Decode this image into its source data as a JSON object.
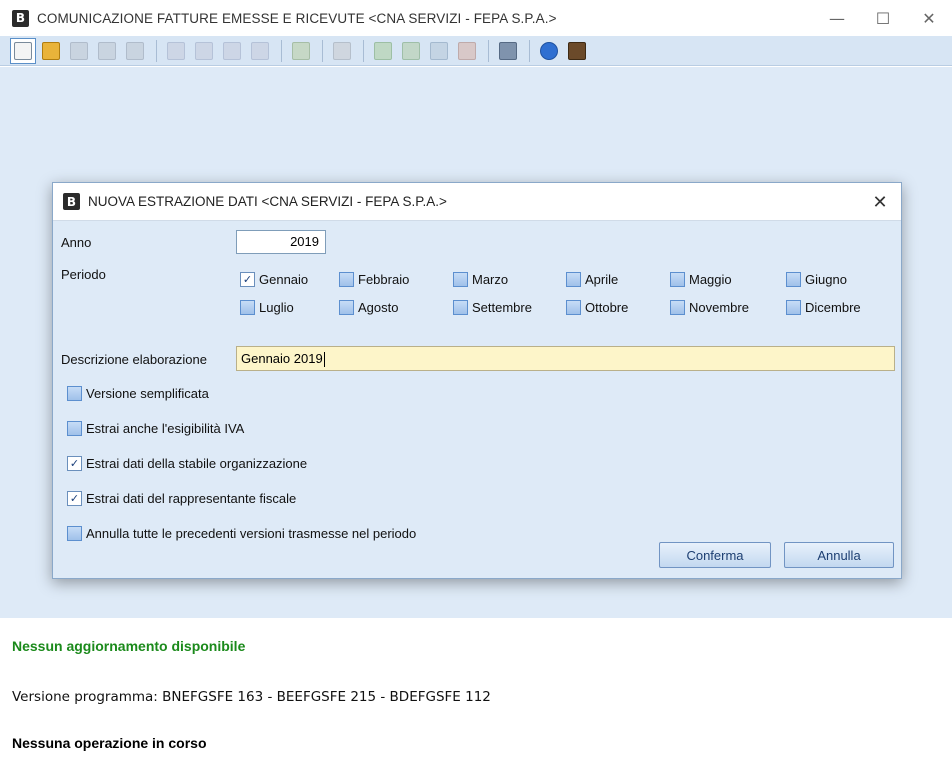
{
  "window": {
    "logo": "B",
    "title": "COMUNICAZIONE FATTURE EMESSE E RICEVUTE <CNA SERVIZI - FEPA S.P.A.>",
    "controls": {
      "minimize": "—",
      "maximize": "☐",
      "close": "✕"
    }
  },
  "toolbar": {
    "icons": [
      {
        "name": "new-document-icon",
        "color": "#f4f4f4",
        "border": "#7a8a9a",
        "selected": true
      },
      {
        "name": "open-folder-icon",
        "color": "#e9b33a",
        "border": "#b07d10"
      },
      {
        "name": "undo-icon",
        "color": "#c9d4e0",
        "border": "#b0bccb"
      },
      {
        "name": "delete-icon",
        "color": "#c9d4e0",
        "border": "#b0bccb"
      },
      {
        "name": "search-binoculars-icon",
        "color": "#c9d4e0",
        "border": "#b0bccb"
      },
      {
        "name": "sep"
      },
      {
        "name": "edit-pencil-icon",
        "color": "#cdd6e6",
        "border": "#b5c2d8"
      },
      {
        "name": "edit-pencil-2-icon",
        "color": "#cdd6e6",
        "border": "#b5c2d8"
      },
      {
        "name": "edit-pencil-3-icon",
        "color": "#cdd6e6",
        "border": "#b5c2d8"
      },
      {
        "name": "cancel-edit-icon",
        "color": "#cdd6e6",
        "border": "#b5c2d8"
      },
      {
        "name": "sep"
      },
      {
        "name": "list-dropdown-icon",
        "color": "#c6d8c6",
        "border": "#a6bea6"
      },
      {
        "name": "sep"
      },
      {
        "name": "settings-gear-icon",
        "color": "#cfd6df",
        "border": "#b5bfcb"
      },
      {
        "name": "sep"
      },
      {
        "name": "user-icon",
        "color": "#bfd8c4",
        "border": "#9dbfa4"
      },
      {
        "name": "chart-icon",
        "color": "#c2d7c8",
        "border": "#9fbfa8"
      },
      {
        "name": "copy-icon",
        "color": "#c4d4e4",
        "border": "#a4b9cf"
      },
      {
        "name": "report-icon",
        "color": "#d8c8c8",
        "border": "#bfaaaa"
      },
      {
        "name": "sep"
      },
      {
        "name": "monitor-icon",
        "color": "#7f93ad",
        "border": "#566a84"
      },
      {
        "name": "sep"
      },
      {
        "name": "help-icon",
        "color": "#2f6fd1",
        "border": "#1f52a0",
        "round": true
      },
      {
        "name": "exit-door-icon",
        "color": "#6b4a2a",
        "border": "#3e2a14"
      }
    ]
  },
  "dialog": {
    "logo": "B",
    "title": "NUOVA ESTRAZIONE DATI <CNA SERVIZI - FEPA S.P.A.>",
    "close": "✕",
    "anno_label": "Anno",
    "anno_value": "2019",
    "periodo_label": "Periodo",
    "months": [
      {
        "label": "Gennaio",
        "checked": true
      },
      {
        "label": "Febbraio",
        "checked": false
      },
      {
        "label": "Marzo",
        "checked": false
      },
      {
        "label": "Aprile",
        "checked": false
      },
      {
        "label": "Maggio",
        "checked": false
      },
      {
        "label": "Giugno",
        "checked": false
      },
      {
        "label": "Luglio",
        "checked": false
      },
      {
        "label": "Agosto",
        "checked": false
      },
      {
        "label": "Settembre",
        "checked": false
      },
      {
        "label": "Ottobre",
        "checked": false
      },
      {
        "label": "Novembre",
        "checked": false
      },
      {
        "label": "Dicembre",
        "checked": false
      }
    ],
    "descrizione_label": "Descrizione elaborazione",
    "descrizione_value": "Gennaio 2019",
    "options": [
      {
        "label": "Versione semplificata",
        "checked": false
      },
      {
        "label": "Estrai anche l'esigibilità IVA",
        "checked": false
      },
      {
        "label": "Estrai dati della stabile organizzazione",
        "checked": true
      },
      {
        "label": "Estrai dati del rappresentante fiscale",
        "checked": true
      },
      {
        "label": "Annulla tutte le precedenti versioni trasmesse nel periodo",
        "checked": false
      }
    ],
    "confirm_label": "Conferma",
    "cancel_label": "Annulla"
  },
  "status": {
    "updates": "Nessun aggiornamento disponibile",
    "version": "Versione programma: BNEFGSFE 163 - BEEFGSFE 215 - BDEFGSFE 112",
    "operation": "Nessuna operazione in corso"
  },
  "colors": {
    "workspace_bg": "#deeaf7",
    "toolbar_bg": "#d7e5f4",
    "input_highlight": "#fdf5c9",
    "status_green": "#1b8a1b"
  }
}
